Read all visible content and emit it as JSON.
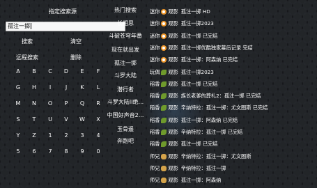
{
  "left_panel": {
    "title": "指定搜索源",
    "search_value": "孤注一掷",
    "actions": {
      "search": "搜索",
      "clear": "清空",
      "remote_search": "远程搜索",
      "delete": "删除"
    },
    "keys": [
      "A",
      "B",
      "C",
      "D",
      "E",
      "F",
      "G",
      "H",
      "I",
      "J",
      "K",
      "L",
      "M",
      "N",
      "O",
      "P",
      "Q",
      "R",
      "S",
      "T",
      "U",
      "V",
      "W",
      "X",
      "Y",
      "Z",
      "1",
      "2",
      "3",
      "4",
      "5",
      "6",
      "7",
      "8",
      "9",
      "0"
    ]
  },
  "middle_menu": [
    "热门搜索",
    "长相思",
    "斗破苍穹年番",
    "现在就出发",
    "孤注一掷",
    "斗罗大陆",
    "潜行者",
    "斗罗大陆II绝...",
    "中国好声音2...",
    "玉骨遥",
    "奔跑吧"
  ],
  "results": [
    {
      "source": "迷你",
      "icon": "orange-film-icon",
      "type": "观影",
      "title": "孤注一掷 HD"
    },
    {
      "source": "迷你",
      "icon": "orange-film-icon",
      "type": "观影",
      "title": "孤注一掷2023"
    },
    {
      "source": "迷你",
      "icon": "orange-film-icon",
      "type": "观影",
      "title": "孤注一掷 已完结"
    },
    {
      "source": "迷你",
      "icon": "orange-film-icon",
      "type": "观影",
      "title": "孤注一掷优酷独家幕后记录 完结"
    },
    {
      "source": "迷你",
      "icon": "orange-film-icon",
      "type": "观影",
      "title": "孤注一掷：阿森纳 已完结"
    },
    {
      "source": "玩偶",
      "icon": "leaf-icon",
      "type": "观影",
      "title": "孤注一掷2023"
    },
    {
      "source": "稻香",
      "icon": "leaf-icon",
      "type": "观影",
      "title": "孤注一掷 已完结"
    },
    {
      "source": "稻香",
      "icon": "leaf-icon",
      "type": "观影",
      "title": "族长老爹的葬礼2：孤注一掷 已完结"
    },
    {
      "source": "稻香",
      "icon": "leaf-icon",
      "type": "观影",
      "title": "辛纳特拉：孤注一掷：尤文图斯 已完结"
    },
    {
      "source": "稻香",
      "icon": "leaf-icon",
      "type": "观影",
      "title": "孤注一掷：阿森纳 已完结"
    },
    {
      "source": "稻香",
      "icon": "leaf-icon",
      "type": "观影",
      "title": "辛纳特拉：孤注一掷 已完结"
    },
    {
      "source": "稻香",
      "icon": "leaf-icon",
      "type": "观影",
      "title": "孤注一掷 已完结"
    },
    {
      "source": "师兄",
      "icon": "cat-icon",
      "type": "观影",
      "title": "辛纳特拉：孤注一掷：尤文图斯"
    },
    {
      "source": "师兄",
      "icon": "cat-icon",
      "type": "观影",
      "title": "辛纳特拉：孤注一掷"
    },
    {
      "source": "师兄",
      "icon": "cat-icon",
      "type": "观影",
      "title": "孤注一掷：阿森纳"
    }
  ]
}
